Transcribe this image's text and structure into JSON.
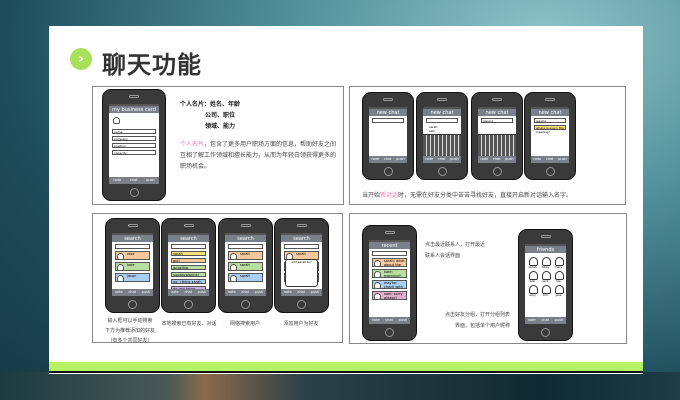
{
  "title": "聊天功能",
  "colors": {
    "accent_green": "#b5f265",
    "highlight_pink": "#f07ab0"
  },
  "panel1": {
    "lines": [
      "个人名片：姓名、年龄",
      "公司、职位",
      "领域、能力"
    ],
    "desc_highlight": "个人名片",
    "desc": "，包含了更多用户职场方面的信息，帮助好友之间互相了解工作领域和擅长能力，从而为年轻白领获得更多的职场机会。"
  },
  "panel2": {
    "desc_pre": "当开始",
    "desc_highlight": "新对话",
    "desc_post": "时，无需在好友分类中苦苦寻找好友，直接开启新对话输入名字。"
  },
  "panel3": {
    "captions": [
      "输入框可以手动搜索\n下方为推荐添加的好友\n（有多个共同好友）",
      "本地搜索已有好友、对话",
      "网络搜索用户",
      "添加用户为好友"
    ]
  },
  "panel4": {
    "caption1": "点击最近联系人，打开最近联系人会话界面",
    "caption2": "点击好友分组，打开分组列表界面，包括单个用户昵称"
  },
  "tabs": [
    "note",
    "chat",
    "push"
  ],
  "phones": [
    {
      "title": "my business card",
      "kind": "card",
      "fields": [
        "name",
        "company",
        "position",
        "capacity"
      ]
    },
    {
      "title": "new chat",
      "kind": "chat"
    },
    {
      "title": "new chat",
      "kind": "chat",
      "keyboard": true,
      "list": [
        "sarah",
        "sam",
        "simon"
      ]
    },
    {
      "title": "new chat",
      "kind": "chat",
      "keyboard": true,
      "field": "jessica"
    },
    {
      "title": "new chat",
      "kind": "chat",
      "field": "jessica",
      "message": "where is every the meeting?"
    },
    {
      "title": "search",
      "kind": "rows",
      "rows": [
        {
          "c": "#f8c89a",
          "t": "rose"
        },
        {
          "c": "#b9dfa0",
          "t": "kate"
        },
        {
          "c": "#a9cdf4",
          "t": "jason"
        }
      ]
    },
    {
      "title": "search",
      "kind": "bars",
      "rows": [
        {
          "c": "#f6e37a",
          "t": "sarah"
        },
        {
          "c": "#f8c89a",
          "t": "ann"
        },
        {
          "c": "#b9dfa0",
          "t": "angelina"
        },
        {
          "c": "#b9dfa0",
          "t": "sundayplanner"
        },
        {
          "c": "#a9cdf4",
          "t": "no, I think sarah will go"
        },
        {
          "c": "#c9b1e4",
          "t": "do you know sarah?"
        }
      ]
    },
    {
      "title": "search",
      "kind": "rows",
      "rows": [
        {
          "c": "#f8c89a",
          "t": "sarah"
        },
        {
          "c": "#b9dfa0",
          "t": "sarah"
        },
        {
          "c": "#a9cdf4",
          "t": "sarah"
        }
      ]
    },
    {
      "title": "search",
      "kind": "rows",
      "dialog": "add sarah to?",
      "rows": [
        {
          "c": "#f8c89a",
          "t": "sarah"
        },
        {
          "c": "#b9dfa0",
          "t": "sarah"
        },
        {
          "c": "#a9cdf4",
          "t": "sarah"
        }
      ]
    },
    {
      "title": "recent",
      "kind": "rows",
      "rows": [
        {
          "c": "#f8c89a",
          "t": "sarah: what about the plan?"
        },
        {
          "c": "#b9dfa0",
          "t": "kate: morning!!"
        },
        {
          "c": "#a9cdf4",
          "t": "maybe: check with it?"
        },
        {
          "c": "#e4b0c8",
          "t": "sam: sorry please!"
        }
      ]
    },
    {
      "title": "friends",
      "kind": "grid",
      "names": [
        "sarah",
        "daisy",
        "mary",
        "bob",
        "jack",
        "lee",
        "amy",
        "tim",
        "jess"
      ]
    }
  ]
}
